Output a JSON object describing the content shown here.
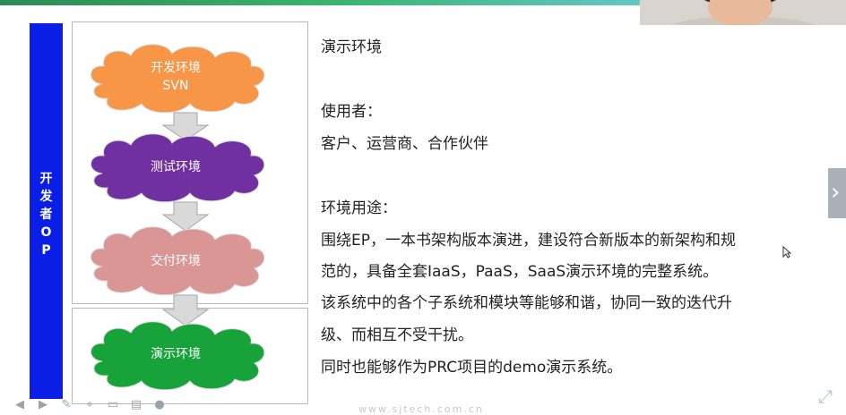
{
  "sidebar": {
    "label_chars": [
      "开",
      "发",
      "者",
      "O",
      "P"
    ]
  },
  "flow": {
    "clouds": [
      {
        "line1": "开发环境",
        "line2": "SVN",
        "color": "#f79646"
      },
      {
        "line1": "测试环境",
        "line2": "",
        "color": "#7030a0"
      },
      {
        "line1": "交付环境",
        "line2": "",
        "color": "#d99694"
      },
      {
        "line1": "演示环境",
        "line2": "",
        "color": "#17a23a"
      }
    ],
    "arrow_color": "#d9d9d9"
  },
  "content": {
    "title": "演示环境",
    "users_heading": "使用者：",
    "users": "客户、运营商、合作伙伴",
    "usage_heading": "环境用途：",
    "usage_lines": [
      "围绕EP，一本书架构版本演进，建设符合新版本的新架构和规",
      "范的，具备全套IaaS，PaaS，SaaS演示环境的完整系统。",
      "该系统中的各个子系统和模块等能够和谐，协同一致的迭代升",
      "级、而相互不受干扰。",
      "同时也能够作为PRC项目的demo演示系统。"
    ]
  },
  "player": {
    "next_slide_glyph": "›",
    "toolbar_icons": [
      "prev-icon",
      "play-icon",
      "pen-icon",
      "select-icon",
      "screen-icon",
      "slides-icon",
      "chat-icon"
    ],
    "watermark": "www.sjtech.com.cn"
  }
}
